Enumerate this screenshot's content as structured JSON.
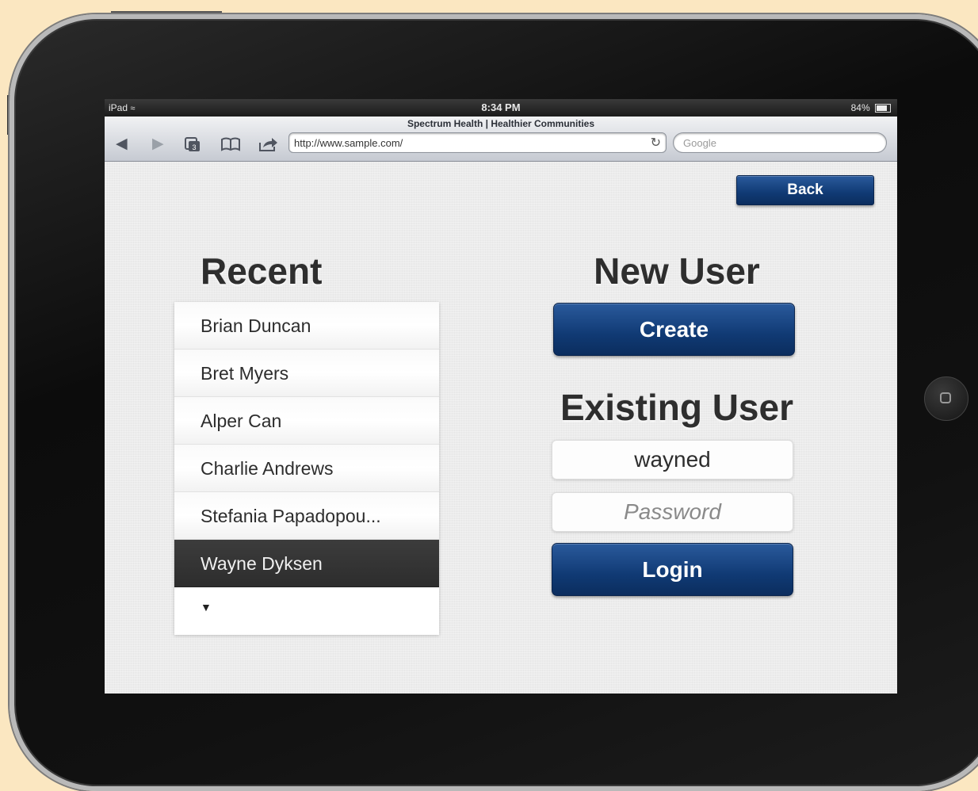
{
  "status_bar": {
    "device": "iPad",
    "time": "8:34 PM",
    "battery": "84%"
  },
  "browser": {
    "page_title": "Spectrum Health | Healthier Communities",
    "url": "http://www.sample.com/",
    "search_placeholder": "Google",
    "tabs_count": "3"
  },
  "app": {
    "back_label": "Back",
    "recent_heading": "Recent",
    "recent_users": [
      "Brian Duncan",
      "Bret Myers",
      "Alper Can",
      "Charlie Andrews",
      "Stefania Papadopou...",
      "Wayne Dyksen"
    ],
    "selected_user": "Wayne Dyksen",
    "more_indicator": "▼",
    "new_user_heading": "New User",
    "create_label": "Create",
    "existing_user_heading": "Existing User",
    "username_value": "wayned",
    "password_placeholder": "Password",
    "login_label": "Login",
    "colors": {
      "button_blue": "#103a74",
      "selected_row": "#333333"
    }
  }
}
